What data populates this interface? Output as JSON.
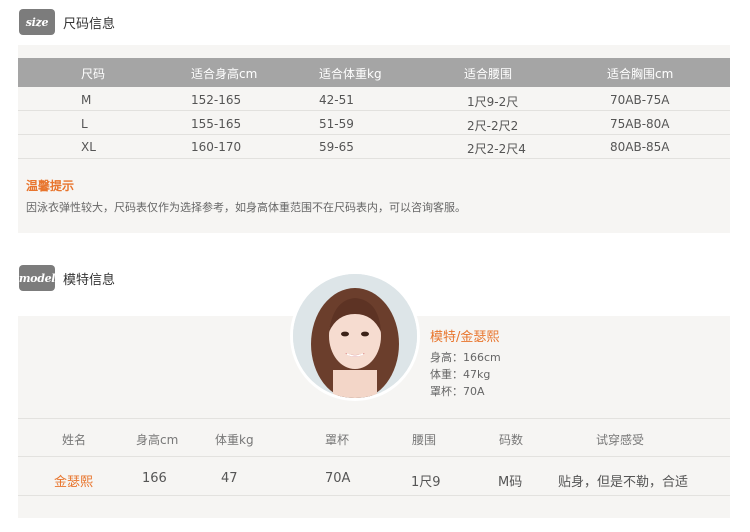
{
  "size_section": {
    "tag": "size",
    "title": "尺码信息",
    "headers": [
      "尺码",
      "适合身高cm",
      "适合体重kg",
      "适合腰围",
      "适合胸围cm"
    ],
    "rows": [
      [
        "M",
        "152-165",
        "42-51",
        "1尺9-2尺",
        "70AB-75A"
      ],
      [
        "L",
        "155-165",
        "51-59",
        "2尺-2尺2",
        "75AB-80A"
      ],
      [
        "XL",
        "160-170",
        "59-65",
        "2尺2-2尺4",
        "80AB-85A"
      ]
    ],
    "tips_title": "温馨提示",
    "tips_text": "因泳衣弹性较大，尺码表仅作为选择参考，如身高体重范围不在尺码表内，可以咨询客服。"
  },
  "model_section": {
    "tag": "model",
    "title": "模特信息",
    "model_name": "模特/金瑟熙",
    "stats": [
      "身高：166cm",
      "体重：47kg",
      "罩杯：70A"
    ],
    "headers": [
      "姓名",
      "身高cm",
      "体重kg",
      "罩杯",
      "腰围",
      "码数",
      "试穿感受"
    ],
    "row": [
      "金瑟熙",
      "166",
      "47",
      "70A",
      "1尺9",
      "M码",
      "贴身，但是不勒，合适"
    ]
  },
  "colors": {
    "accent": "#e8752d",
    "table_header": "#a5a5a5",
    "panel": "#f6f5f3",
    "tag": "#7c7c7c"
  }
}
